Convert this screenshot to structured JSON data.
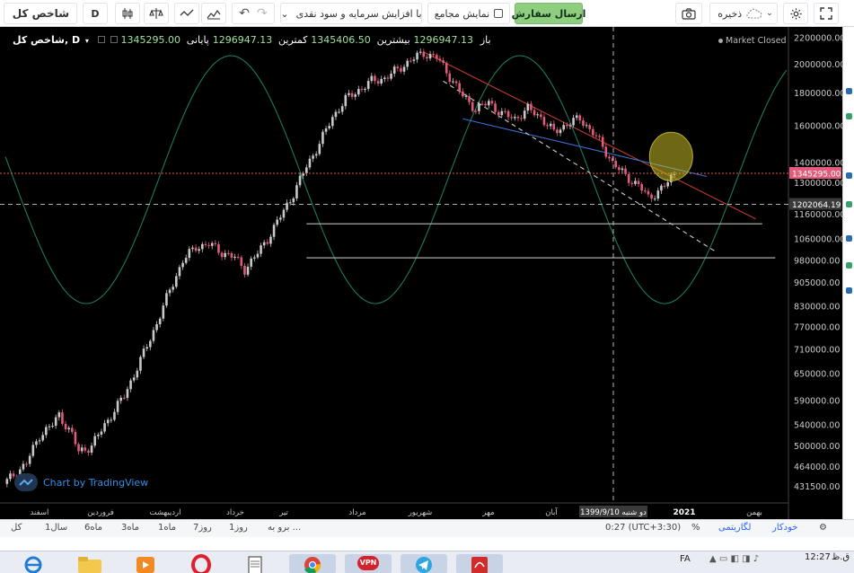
{
  "toolbar": {
    "symbol_title": "شاخص کل",
    "interval": "D",
    "adjust_label": "با افزایش سرمایه و سود نقدی",
    "cumulative_label": "نمایش مجامع",
    "send_order_label": "ارسال سفارش",
    "save_label": "ذخیره"
  },
  "legend": {
    "name": "شاخص کل, D",
    "open_label": "باز",
    "open_value": "1296947.13",
    "high_label": "بیشترین",
    "high_value": "1345406.50",
    "low_label": "کمترین",
    "low_value": "1296947.13",
    "close_label": "پایانی",
    "close_value": "1345295.00",
    "market_status": "Market Closed"
  },
  "watermark": "Chart by TradingView",
  "price_axis": {
    "ticks": [
      "2200000.00",
      "2000000.00",
      "1800000.00",
      "1600000.00",
      "1400000.00",
      "1300000.00",
      "1160000.00",
      "1060000.00",
      "980000.00",
      "905000.00",
      "830000.00",
      "770000.00",
      "710000.00",
      "650000.00",
      "590000.00",
      "540000.00",
      "500000.00",
      "464000.00",
      "431500.00"
    ],
    "last_price_label": "1345295.00",
    "crosshair_label": "1202064.19"
  },
  "time_axis": {
    "ticks": [
      "اسفند",
      "فروردین",
      "اردیبهشت",
      "خرداد",
      "تیر",
      "مرداد",
      "شهریور",
      "مهر",
      "آبان",
      "بهمن"
    ],
    "crosshair_label": "دو شنبه 1399/9/10",
    "year_label": "2021"
  },
  "bottombar": {
    "goto_label": "برو به ...",
    "ranges": [
      "1روز",
      "7روز",
      "1ماه",
      "3ماه",
      "6ماه",
      "1سال",
      "کل"
    ],
    "time_label": "0:27 (UTC+3:30)",
    "percent_label": "%",
    "log_label": "لگاریتمی",
    "auto_label": "خودکار"
  },
  "taskbar": {
    "lang": "FA",
    "clock": "12:27",
    "ampm": "ق.ظ",
    "vpn_label": "VPN"
  },
  "chart_data": {
    "type": "candlestick",
    "title": "شاخص کل, D",
    "ylim": [
      420000,
      2230000
    ],
    "log_scale": true,
    "grid": false,
    "colors": {
      "up": "#c8c8c8",
      "down": "#e05c7a",
      "background": "#000000",
      "cycle": "#1a7a62"
    },
    "anchors": [
      [
        0,
        440000
      ],
      [
        6,
        470000
      ],
      [
        10,
        520000
      ],
      [
        14,
        540000
      ],
      [
        16,
        560000
      ],
      [
        20,
        520000
      ],
      [
        22,
        490000
      ],
      [
        26,
        500000
      ],
      [
        30,
        540000
      ],
      [
        36,
        600000
      ],
      [
        42,
        700000
      ],
      [
        46,
        780000
      ],
      [
        50,
        880000
      ],
      [
        54,
        980000
      ],
      [
        58,
        1030000
      ],
      [
        62,
        1040000
      ],
      [
        66,
        1010000
      ],
      [
        70,
        990000
      ],
      [
        73,
        950000
      ],
      [
        76,
        990000
      ],
      [
        80,
        1060000
      ],
      [
        84,
        1150000
      ],
      [
        88,
        1250000
      ],
      [
        92,
        1380000
      ],
      [
        96,
        1500000
      ],
      [
        100,
        1650000
      ],
      [
        104,
        1760000
      ],
      [
        108,
        1820000
      ],
      [
        112,
        1880000
      ],
      [
        116,
        1900000
      ],
      [
        120,
        1960000
      ],
      [
        124,
        2030000
      ],
      [
        128,
        2080000
      ],
      [
        132,
        2050000
      ],
      [
        134,
        1980000
      ],
      [
        137,
        1880000
      ],
      [
        140,
        1780000
      ],
      [
        144,
        1700000
      ],
      [
        148,
        1740000
      ],
      [
        152,
        1670000
      ],
      [
        156,
        1640000
      ],
      [
        160,
        1700000
      ],
      [
        164,
        1650000
      ],
      [
        168,
        1560000
      ],
      [
        172,
        1610000
      ],
      [
        176,
        1640000
      ],
      [
        180,
        1560000
      ],
      [
        183,
        1480000
      ],
      [
        186,
        1400000
      ],
      [
        190,
        1330000
      ],
      [
        194,
        1290000
      ],
      [
        197,
        1230000
      ],
      [
        200,
        1260000
      ],
      [
        203,
        1300000
      ],
      [
        205,
        1345295
      ]
    ],
    "trendlines": [
      {
        "name": "red",
        "color": "#c0392b",
        "from": [
          128,
          2090000
        ],
        "to": [
          230,
          1140000
        ]
      },
      {
        "name": "blue",
        "color": "#3b6fd6",
        "from": [
          140,
          1640000
        ],
        "to": [
          215,
          1330000
        ]
      },
      {
        "name": "white-dashed",
        "color": "#cccccc",
        "from": [
          134,
          1880000
        ],
        "to": [
          218,
          1010000
        ]
      }
    ],
    "horizontal_lines": [
      {
        "price": 1120000,
        "from": 92,
        "to": 232
      },
      {
        "price": 990000,
        "from": 92,
        "to": 236
      }
    ],
    "highlight_circle": {
      "index": 204,
      "price": 1430000
    }
  }
}
